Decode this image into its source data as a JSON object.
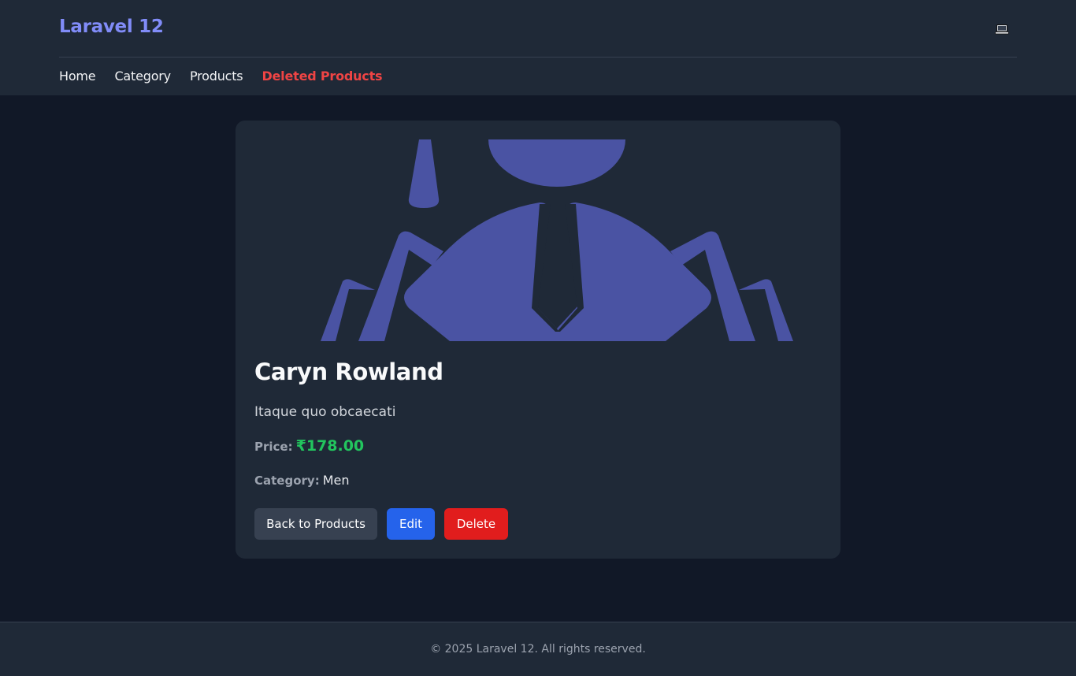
{
  "header": {
    "brand": "Laravel 12",
    "theme_icon": "laptop-icon",
    "nav": [
      {
        "label": "Home"
      },
      {
        "label": "Category"
      },
      {
        "label": "Products"
      },
      {
        "label": "Deleted Products"
      }
    ]
  },
  "product": {
    "image_icon": "placeholder-person-image",
    "name": "Caryn Rowland",
    "description": "Itaque quo obcaecati",
    "price_label": "Price:",
    "price": "₹178.00",
    "category_label": "Category:",
    "category": "Men"
  },
  "actions": {
    "back": "Back to Products",
    "edit": "Edit",
    "delete": "Delete"
  },
  "footer": {
    "text": "© 2025 Laravel 12. All rights reserved."
  },
  "colors": {
    "page_bg": "#111827",
    "panel_bg": "#1f2937",
    "brand": "#818cf8",
    "active_nav": "#ef4444",
    "price": "#22c55e",
    "edit": "#2563eb",
    "delete": "#e11d1d",
    "image_fill": "#4a53a3"
  }
}
